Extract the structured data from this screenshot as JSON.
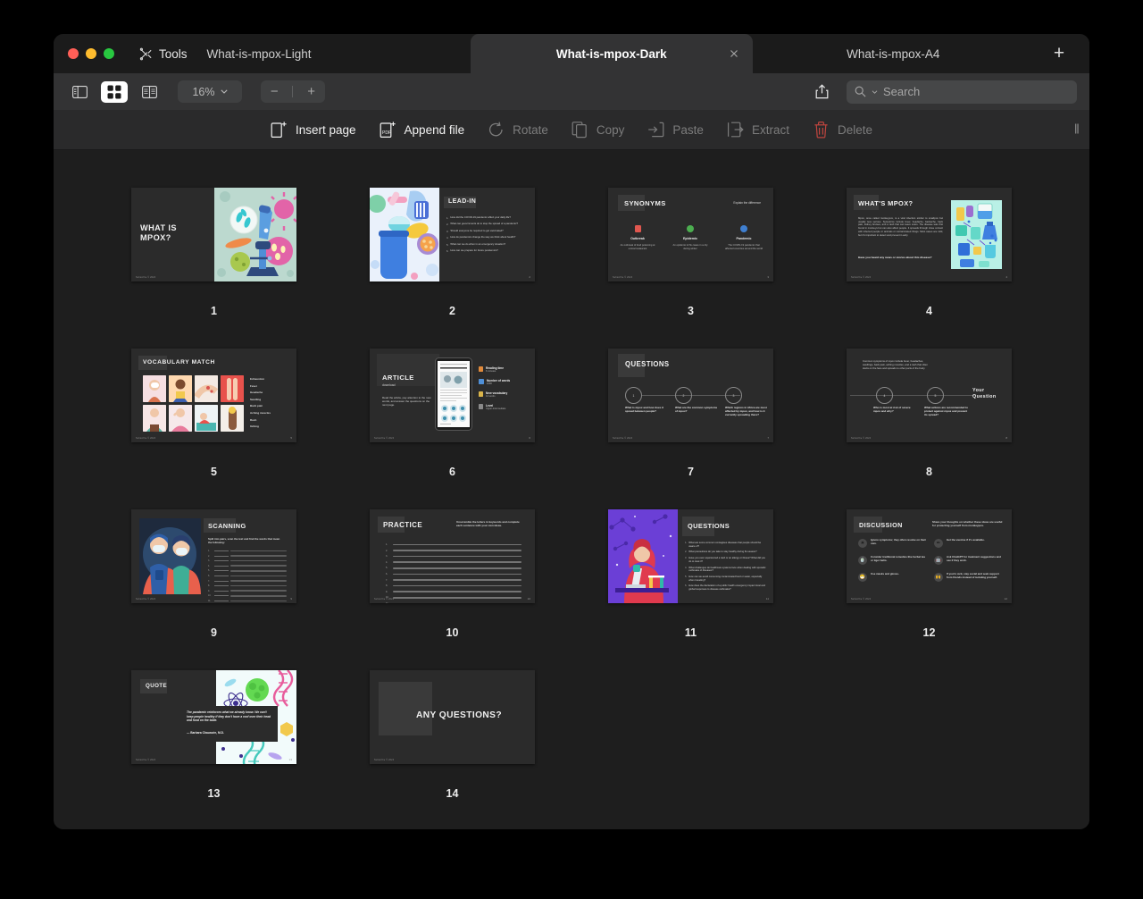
{
  "window": {
    "traffic_lights": [
      "close",
      "minimize",
      "zoom"
    ],
    "tools_label": "Tools"
  },
  "tabs": [
    {
      "label": "What-is-mpox-Light",
      "active": false,
      "closable": false
    },
    {
      "label": "What-is-mpox-Dark",
      "active": true,
      "closable": true
    },
    {
      "label": "What-is-mpox-A4",
      "active": false,
      "closable": false
    }
  ],
  "new_tab_label": "+",
  "toolbar": {
    "view_modes": [
      {
        "name": "sidebar-view",
        "selected": false
      },
      {
        "name": "grid-view",
        "selected": true
      },
      {
        "name": "two-page-view",
        "selected": false
      }
    ],
    "zoom_level": "16%",
    "zoom_out_label": "−",
    "zoom_in_label": "+",
    "share_label": "share-icon",
    "search_placeholder": "Search",
    "search_value": ""
  },
  "actions": [
    {
      "label": "Insert page",
      "icon": "insert-page-icon",
      "enabled": true
    },
    {
      "label": "Append file",
      "icon": "append-file-icon",
      "enabled": true
    },
    {
      "label": "Rotate",
      "icon": "rotate-icon",
      "enabled": false
    },
    {
      "label": "Copy",
      "icon": "copy-icon",
      "enabled": false
    },
    {
      "label": "Paste",
      "icon": "paste-icon",
      "enabled": false
    },
    {
      "label": "Extract",
      "icon": "extract-icon",
      "enabled": false
    },
    {
      "label": "Delete",
      "icon": "trash-icon",
      "enabled": false,
      "color": "#c0453f"
    }
  ],
  "grip_label": "‖",
  "colors": {
    "window_bg": "#1e1e1e",
    "toolbar_bg": "#333334",
    "actionbar_bg": "#2a2a2b",
    "slide_bg": "#2b2b2b",
    "accent_red": "#c0453f",
    "tab_active_bg": "#333334"
  },
  "pages": [
    {
      "number": "1",
      "layout": "title-split",
      "title": "WHAT IS MPOX?",
      "footer": "Subscribe © 2024",
      "illustration": "microscope-virus-illustration"
    },
    {
      "number": "2",
      "layout": "image-left-list-right",
      "title": "LEAD-IN",
      "illustration": "pills-medicine-illustration",
      "items": [
        "How did the COVID-19 pandemic affect your daily life?",
        "What can governments do to stop the spread of a pandemic?",
        "Should everyone be required to get vaccinated?",
        "How do pandemics change the way we think about health?",
        "What can we do when in an emergency situation?",
        "How can we prepare for future pandemics?"
      ]
    },
    {
      "number": "3",
      "layout": "three-columns",
      "title": "SYNONYMS",
      "subtitle": "Explain the difference",
      "columns": [
        {
          "name": "Outbreak",
          "text": "An outbreak of food poisoning at a local restaurant",
          "color": "#e0574f"
        },
        {
          "name": "Epidemic",
          "text": "An epidemic of flu cases in a city during winter",
          "color": "#4cae50"
        },
        {
          "name": "Pandemic",
          "text": "The COVID-19 pandemic that affected countries around the world",
          "color": "#3f7fd0"
        }
      ]
    },
    {
      "number": "4",
      "layout": "text-left-image-right",
      "title": "WHAT'S MPOX?",
      "body": "Mpox, once called monkeypox, is a viral infection similar to smallpox but usually less serious. Symptoms include fever, headache, backache, back pain, kidney bruises, and a rash that can leave scars. The disease was first found in monkeys but can also affect people. It spreads through close contact with infected people or animals or contaminated things. Most cases are mild, but it's important to detect and prevent it early.",
      "question": "Have you heard any news or stories about this disease?",
      "illustration": "lab-glassware-illustration"
    },
    {
      "number": "5",
      "layout": "image-grid-words",
      "title": "VOCABULARY MATCH",
      "words": [
        "Exhaustion",
        "Fever",
        "Headache",
        "Swelling",
        "Back pain",
        "Aching muscles",
        "Rash",
        "Itching"
      ],
      "cards": 8
    },
    {
      "number": "6",
      "layout": "article-tablet",
      "title": "ARTICLE",
      "subtitle": "download",
      "body": "Read the article, pay attention to the new words, and answer the questions on the next page.",
      "stats": [
        {
          "label": "Reading time",
          "value": "6 minutes"
        },
        {
          "label": "Number of words",
          "value": "1000"
        },
        {
          "label": "New vocabulary",
          "value": "12 words"
        },
        {
          "label": "Level",
          "value": "Upper-Intermediate"
        }
      ]
    },
    {
      "number": "7",
      "layout": "questions-circles",
      "title": "QUESTIONS",
      "questions": [
        {
          "n": "1",
          "text": "What is mpox and how does it spread between people?"
        },
        {
          "n": "2",
          "text": "What are the common symptoms of mpox?"
        },
        {
          "n": "3",
          "text": "Which regions in Africa are most affected by mpox, and how is it currently spreading there?"
        }
      ]
    },
    {
      "number": "8",
      "layout": "questions-continued",
      "intro": "Common symptoms of mpox include fever, headaches, swellings, back pain, aching muscles, and a rash that often starts on the face and spreads to other parts of the body.",
      "questions": [
        {
          "n": "4",
          "text": "Who is most at risk of severe mpox and why?"
        },
        {
          "n": "5",
          "text": "What actions are recommended to protect against mpox and prevent its spread?"
        }
      ],
      "aside": "Your Question"
    },
    {
      "number": "9",
      "layout": "scanning",
      "title": "SCANNING",
      "body": "Split into pairs, scan the text and find the words that mean the following:",
      "illustration": "two-medical-workers-illustration",
      "items_count": 12
    },
    {
      "number": "10",
      "layout": "practice",
      "title": "PRACTICE",
      "subtitle": "Unscramble the letters in keywords and complete each sentence with your own ideas.",
      "items_count": 11
    },
    {
      "number": "11",
      "layout": "image-left-questions-right",
      "title": "QUESTIONS",
      "illustration": "scientist-microscope-purple-illustration",
      "questions": [
        "What are some common contagious diseases that people should be aware of?",
        "What precautions do you take to stay healthy during flu season?",
        "Have you ever experienced a rash or an allergy or illness? What did you do to treat it?",
        "What challenges do healthcare systems face when dealing with sporadic outbreaks of diseases?",
        "How can we avoid consuming contaminated food or water, especially when traveling?",
        "How does the declaration of a public health emergency impact local and global responses to disease outbreaks?"
      ]
    },
    {
      "number": "12",
      "layout": "discussion",
      "title": "DISCUSSION",
      "subtitle": "Share your thoughts on whether these ideas are useful for protecting yourself from monkeypox.",
      "items": [
        {
          "icon": "sun-icon",
          "text": "Ignore symptoms; they often resolve on their own."
        },
        {
          "icon": "pencil-icon",
          "text": "Get the vaccine if it's available."
        },
        {
          "icon": "herbs-icon",
          "text": "Consider traditional remedies like herbal tea or tiger balm."
        },
        {
          "icon": "robot-icon",
          "text": "Ask ChatGPT for treatment suggestions and see if they work."
        },
        {
          "icon": "mask-icon",
          "text": "Use masks and gloves."
        },
        {
          "icon": "hands-icon",
          "text": "If you're sick, stay social and seek support from friends instead of isolating yourself."
        }
      ]
    },
    {
      "number": "13",
      "layout": "quote",
      "title": "QUOTE",
      "quote": "The pandemic reinforces what we already know. We can't keep people healthy if they don't have a roof over their head and food on the table.",
      "attribution": "— Barbara Chaussée, M.D.",
      "illustration": "science-pattern-illustration"
    },
    {
      "number": "14",
      "layout": "closing",
      "title": "ANY QUESTIONS?",
      "footer": "Subscribe © 2024"
    }
  ]
}
